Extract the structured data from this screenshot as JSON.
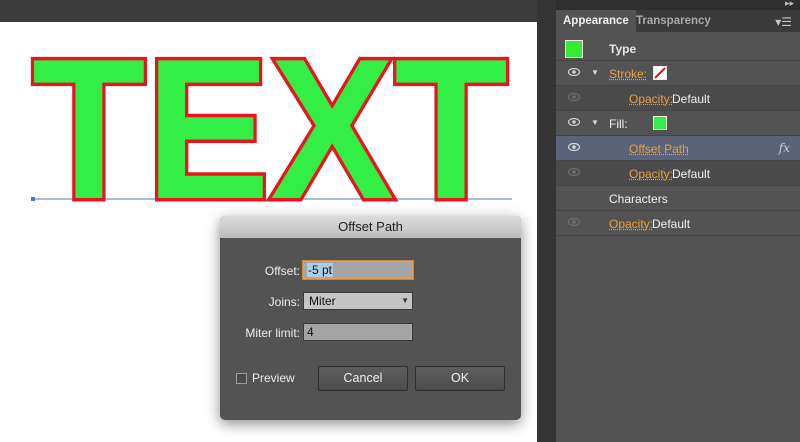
{
  "artwork": {
    "text": "TEXT",
    "fill_color": "#33ee44",
    "stroke_color": "#e8151f",
    "baseline_color": "#4a78d0"
  },
  "panel": {
    "tabs": [
      {
        "label": "Appearance"
      },
      {
        "label": "Transparency"
      }
    ],
    "rows": {
      "type": {
        "label": "Type"
      },
      "stroke": {
        "label": "Stroke:"
      },
      "stroke_opacity": {
        "label": "Opacity:",
        "value": "Default"
      },
      "fill": {
        "label": "Fill:",
        "color": "#33ee44"
      },
      "offset_path": {
        "label": "Offset Path"
      },
      "fill_opacity": {
        "label": "Opacity:",
        "value": "Default"
      },
      "characters": {
        "label": "Characters"
      },
      "opacity": {
        "label": "Opacity:",
        "value": "Default"
      }
    }
  },
  "dialog": {
    "title": "Offset Path",
    "offset": {
      "label": "Offset:",
      "value": "-5 pt"
    },
    "joins": {
      "label": "Joins:",
      "value": "Miter"
    },
    "miter_limit": {
      "label": "Miter limit:",
      "value": "4"
    },
    "preview": {
      "label": "Preview",
      "checked": false
    },
    "cancel_label": "Cancel",
    "ok_label": "OK"
  }
}
